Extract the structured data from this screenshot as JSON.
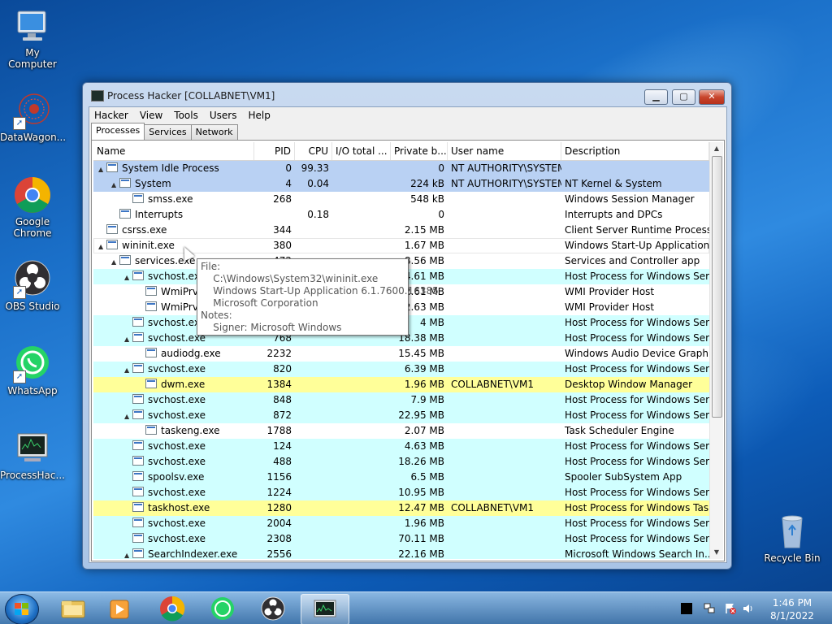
{
  "desktop": {
    "icons": [
      {
        "label": "My Computer"
      },
      {
        "label": "DataWagon..."
      },
      {
        "label": "Google Chrome"
      },
      {
        "label": "OBS Studio"
      },
      {
        "label": "WhatsApp"
      },
      {
        "label": "ProcessHac..."
      },
      {
        "label": "Recycle Bin"
      }
    ]
  },
  "window": {
    "title": "Process Hacker [COLLABNET\\VM1]",
    "menu": [
      "Hacker",
      "View",
      "Tools",
      "Users",
      "Help"
    ],
    "tabs": [
      "Processes",
      "Services",
      "Network"
    ],
    "active_tab": "Processes",
    "columns": [
      "Name",
      "PID",
      "CPU",
      "I/O total ...",
      "Private b...",
      "User name",
      "Description"
    ],
    "rows": [
      {
        "name": "System Idle Process",
        "pid": "0",
        "cpu": "99.33",
        "io": "",
        "priv": "0",
        "user": "NT AUTHORITY\\SYSTEM",
        "desc": "",
        "depth": 0,
        "exp": "▲",
        "bg": "#b9d1f3"
      },
      {
        "name": "System",
        "pid": "4",
        "cpu": "0.04",
        "io": "",
        "priv": "224 kB",
        "user": "NT AUTHORITY\\SYSTEM",
        "desc": "NT Kernel & System",
        "depth": 1,
        "exp": "▲",
        "bg": "#b9d1f3"
      },
      {
        "name": "smss.exe",
        "pid": "268",
        "cpu": "",
        "io": "",
        "priv": "548 kB",
        "user": "",
        "desc": "Windows Session Manager",
        "depth": 2,
        "exp": "",
        "bg": "#ffffff"
      },
      {
        "name": "Interrupts",
        "pid": "",
        "cpu": "0.18",
        "io": "",
        "priv": "0",
        "user": "",
        "desc": "Interrupts and DPCs",
        "depth": 1,
        "exp": "",
        "bg": "#ffffff"
      },
      {
        "name": "csrss.exe",
        "pid": "344",
        "cpu": "",
        "io": "",
        "priv": "2.15 MB",
        "user": "",
        "desc": "Client Server Runtime Process",
        "depth": 0,
        "exp": "",
        "bg": "#ffffff"
      },
      {
        "name": "wininit.exe",
        "pid": "380",
        "cpu": "",
        "io": "",
        "priv": "1.67 MB",
        "user": "",
        "desc": "Windows Start-Up Application",
        "depth": 0,
        "exp": "▲",
        "bg": "#ffffff",
        "hover": true
      },
      {
        "name": "services.exe",
        "pid": "472",
        "cpu": "",
        "io": "",
        "priv": "8.56 MB",
        "user": "",
        "desc": "Services and Controller app",
        "depth": 1,
        "exp": "▲",
        "bg": "#ffffff"
      },
      {
        "name": "svchost.exe",
        "pid": "",
        "cpu": "",
        "io": "",
        "priv": "4.61 MB",
        "user": "",
        "desc": "Host Process for Windows Ser...",
        "depth": 2,
        "exp": "▲",
        "bg": "#d0ffff"
      },
      {
        "name": "WmiPrvSE.exe",
        "pid": "",
        "cpu": "",
        "io": "",
        "priv": "2.61 MB",
        "user": "",
        "desc": "WMI Provider Host",
        "depth": 3,
        "exp": "",
        "bg": "#ffffff"
      },
      {
        "name": "WmiPrvSE.exe",
        "pid": "",
        "cpu": "",
        "io": "",
        "priv": "2.63 MB",
        "user": "",
        "desc": "WMI Provider Host",
        "depth": 3,
        "exp": "",
        "bg": "#ffffff"
      },
      {
        "name": "svchost.exe",
        "pid": "",
        "cpu": "",
        "io": "",
        "priv": "4 MB",
        "user": "",
        "desc": "Host Process for Windows Ser...",
        "depth": 2,
        "exp": "",
        "bg": "#d0ffff"
      },
      {
        "name": "svchost.exe",
        "pid": "768",
        "cpu": "",
        "io": "",
        "priv": "18.38 MB",
        "user": "",
        "desc": "Host Process for Windows Ser...",
        "depth": 2,
        "exp": "▲",
        "bg": "#d0ffff"
      },
      {
        "name": "audiodg.exe",
        "pid": "2232",
        "cpu": "",
        "io": "",
        "priv": "15.45 MB",
        "user": "",
        "desc": "Windows Audio Device Graph...",
        "depth": 3,
        "exp": "",
        "bg": "#ffffff"
      },
      {
        "name": "svchost.exe",
        "pid": "820",
        "cpu": "",
        "io": "",
        "priv": "6.39 MB",
        "user": "",
        "desc": "Host Process for Windows Ser...",
        "depth": 2,
        "exp": "▲",
        "bg": "#d0ffff"
      },
      {
        "name": "dwm.exe",
        "pid": "1384",
        "cpu": "",
        "io": "",
        "priv": "1.96 MB",
        "user": "COLLABNET\\VM1",
        "desc": "Desktop Window Manager",
        "depth": 3,
        "exp": "",
        "bg": "#ffff99"
      },
      {
        "name": "svchost.exe",
        "pid": "848",
        "cpu": "",
        "io": "",
        "priv": "7.9 MB",
        "user": "",
        "desc": "Host Process for Windows Ser...",
        "depth": 2,
        "exp": "",
        "bg": "#d0ffff"
      },
      {
        "name": "svchost.exe",
        "pid": "872",
        "cpu": "",
        "io": "",
        "priv": "22.95 MB",
        "user": "",
        "desc": "Host Process for Windows Ser...",
        "depth": 2,
        "exp": "▲",
        "bg": "#d0ffff"
      },
      {
        "name": "taskeng.exe",
        "pid": "1788",
        "cpu": "",
        "io": "",
        "priv": "2.07 MB",
        "user": "",
        "desc": "Task Scheduler Engine",
        "depth": 3,
        "exp": "",
        "bg": "#ffffff"
      },
      {
        "name": "svchost.exe",
        "pid": "124",
        "cpu": "",
        "io": "",
        "priv": "4.63 MB",
        "user": "",
        "desc": "Host Process for Windows Ser...",
        "depth": 2,
        "exp": "",
        "bg": "#d0ffff"
      },
      {
        "name": "svchost.exe",
        "pid": "488",
        "cpu": "",
        "io": "",
        "priv": "18.26 MB",
        "user": "",
        "desc": "Host Process for Windows Ser...",
        "depth": 2,
        "exp": "",
        "bg": "#d0ffff"
      },
      {
        "name": "spoolsv.exe",
        "pid": "1156",
        "cpu": "",
        "io": "",
        "priv": "6.5 MB",
        "user": "",
        "desc": "Spooler SubSystem App",
        "depth": 2,
        "exp": "",
        "bg": "#d0ffff"
      },
      {
        "name": "svchost.exe",
        "pid": "1224",
        "cpu": "",
        "io": "",
        "priv": "10.95 MB",
        "user": "",
        "desc": "Host Process for Windows Ser...",
        "depth": 2,
        "exp": "",
        "bg": "#d0ffff"
      },
      {
        "name": "taskhost.exe",
        "pid": "1280",
        "cpu": "",
        "io": "",
        "priv": "12.47 MB",
        "user": "COLLABNET\\VM1",
        "desc": "Host Process for Windows Tas...",
        "depth": 2,
        "exp": "",
        "bg": "#ffff99"
      },
      {
        "name": "svchost.exe",
        "pid": "2004",
        "cpu": "",
        "io": "",
        "priv": "1.96 MB",
        "user": "",
        "desc": "Host Process for Windows Ser...",
        "depth": 2,
        "exp": "",
        "bg": "#d0ffff"
      },
      {
        "name": "svchost.exe",
        "pid": "2308",
        "cpu": "",
        "io": "",
        "priv": "70.11 MB",
        "user": "",
        "desc": "Host Process for Windows Ser...",
        "depth": 2,
        "exp": "",
        "bg": "#d0ffff"
      },
      {
        "name": "SearchIndexer.exe",
        "pid": "2556",
        "cpu": "",
        "io": "",
        "priv": "22.16 MB",
        "user": "",
        "desc": "Microsoft Windows Search In...",
        "depth": 2,
        "exp": "▲",
        "bg": "#d0ffff"
      }
    ]
  },
  "tooltip": {
    "lines": [
      "File:",
      "    C:\\Windows\\System32\\wininit.exe",
      "    Windows Start-Up Application 6.1.7600.16385",
      "    Microsoft Corporation",
      "Notes:",
      "    Signer: Microsoft Windows"
    ]
  },
  "taskbar": {
    "apps": [
      "explorer-icon",
      "media-player-icon",
      "chrome-icon",
      "whatsapp-icon",
      "obs-icon",
      "process-hacker-icon"
    ],
    "clock_time": "1:46 PM",
    "clock_date": "8/1/2022"
  }
}
